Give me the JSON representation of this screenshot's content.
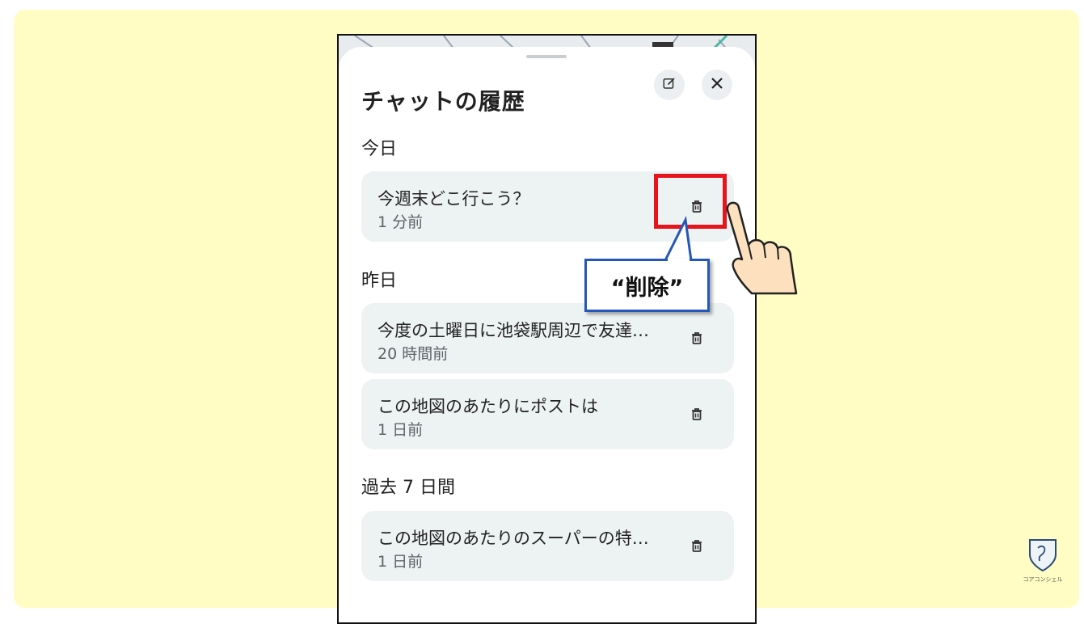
{
  "sheet": {
    "title": "チャットの履歴",
    "edit_icon": "edit-icon",
    "close_icon": "close-icon"
  },
  "sections": [
    {
      "label": "今日",
      "items": [
        {
          "title": "今週末どこ行こう？",
          "time": "1 分前",
          "icon": "trash-icon"
        }
      ]
    },
    {
      "label": "昨日",
      "items": [
        {
          "title": "今度の土曜日に池袋駅周辺で友達…",
          "time": "20 時間前",
          "icon": "trash-icon"
        },
        {
          "title": "この地図のあたりにポストは",
          "time": "1 日前",
          "icon": "trash-icon"
        }
      ]
    },
    {
      "label": "過去 7 日間",
      "items": [
        {
          "title": "この地図のあたりのスーパーの特…",
          "time": "1 日前",
          "icon": "trash-icon"
        }
      ]
    }
  ],
  "annotation": {
    "callout_text": "“削除”",
    "highlight_color": "#e8141c",
    "callout_border_color": "#2457b8"
  },
  "watermark": {
    "brand": "コアコンシェル"
  },
  "colors": {
    "background": "#fffdc3",
    "card": "#edf2f3"
  }
}
